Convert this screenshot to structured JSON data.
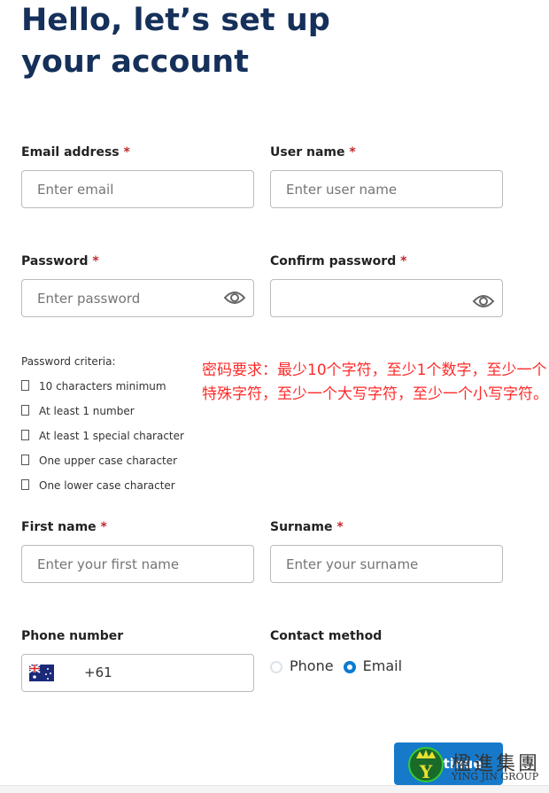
{
  "title": "Hello, let’s set up your account",
  "fields": {
    "email": {
      "label": "Email address",
      "required": "*",
      "placeholder": "Enter email"
    },
    "username": {
      "label": "User name",
      "required": "*",
      "placeholder": "Enter user name"
    },
    "password": {
      "label": "Password",
      "required": "*",
      "placeholder": "Enter password"
    },
    "confirm": {
      "label": "Confirm password",
      "required": "*",
      "placeholder": ""
    },
    "first": {
      "label": "First name",
      "required": "*",
      "placeholder": "Enter your first name"
    },
    "surname": {
      "label": "Surname",
      "required": "*",
      "placeholder": "Enter your surname"
    },
    "phone": {
      "label": "Phone number",
      "code": "+61",
      "flag": "australia-flag"
    }
  },
  "criteria": {
    "title": "Password criteria:",
    "items": [
      "10 characters minimum",
      "At least 1 number",
      "At least 1 special character",
      "One upper case character",
      "One lower case character"
    ]
  },
  "annotation": "密码要求：最少10个字符，至少1个数字，至少一个特殊字符，至少一个大写字符，至少一个小写字符。",
  "contact": {
    "label": "Contact method",
    "options": [
      "Phone",
      "Email"
    ],
    "selected": "Email"
  },
  "continue_label": "Continue",
  "watermark": {
    "chinese": "楹進集團",
    "english": "YING JIN GROUP"
  },
  "colors": {
    "title": "#15305a",
    "accent": "#1779c9",
    "required": "#c0282d",
    "annotation": "#ff2a2a"
  }
}
